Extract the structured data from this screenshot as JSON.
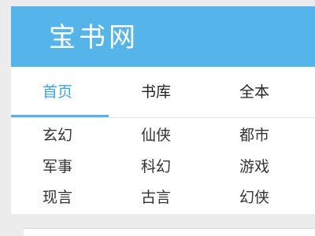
{
  "header": {
    "logo_text": "宝书网"
  },
  "nav": {
    "tabs": [
      {
        "label": "首页",
        "active": true
      },
      {
        "label": "书库",
        "active": false
      },
      {
        "label": "全本",
        "active": false
      }
    ]
  },
  "categories": {
    "rows": [
      [
        "玄幻",
        "仙侠",
        "都市"
      ],
      [
        "军事",
        "科幻",
        "游戏"
      ],
      [
        "现言",
        "古言",
        "幻侠"
      ]
    ]
  },
  "colors": {
    "accent": "#55b5ea",
    "active_text": "#3aa5e0",
    "page_bg": "#ececec"
  }
}
